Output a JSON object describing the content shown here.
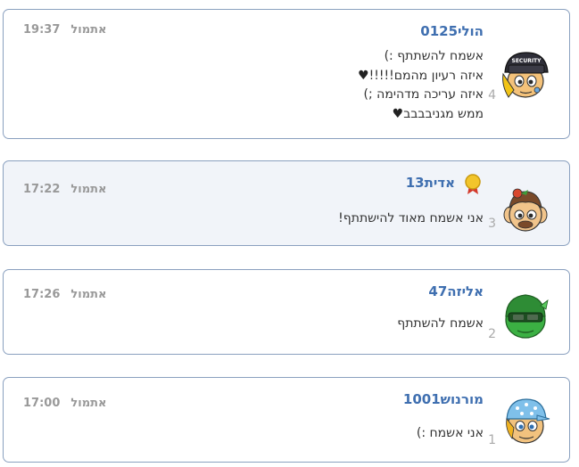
{
  "posts": [
    {
      "username": "הולי0125",
      "time": "19:37",
      "day": "אתמול",
      "number": "4",
      "avatar": "security-cap-avatar",
      "lines": [
        "אשמח להשתתף :)",
        "איזה רעיון מהמם!!!!!",
        "איזה עריכה מדהימה ;)",
        "ממש מגניבבבב"
      ]
    },
    {
      "username": "אדית13",
      "time": "17:22",
      "day": "אתמול",
      "number": "3",
      "avatar": "flower-hair-avatar",
      "badge": "gold-medal-icon",
      "lines": [
        "אני אשמח מאוד להישתתף!"
      ]
    },
    {
      "username": "אליזה47",
      "time": "17:26",
      "day": "אתמול",
      "number": "2",
      "avatar": "green-helmet-avatar",
      "lines": [
        "אשמח להשתתף"
      ]
    },
    {
      "username": "מורנוש1001",
      "time": "17:00",
      "day": "אתמול",
      "number": "1",
      "avatar": "blue-dotted-cap-avatar",
      "lines": [
        "אני אשמח :)"
      ]
    }
  ],
  "heart_icon": "black-heart-icon"
}
